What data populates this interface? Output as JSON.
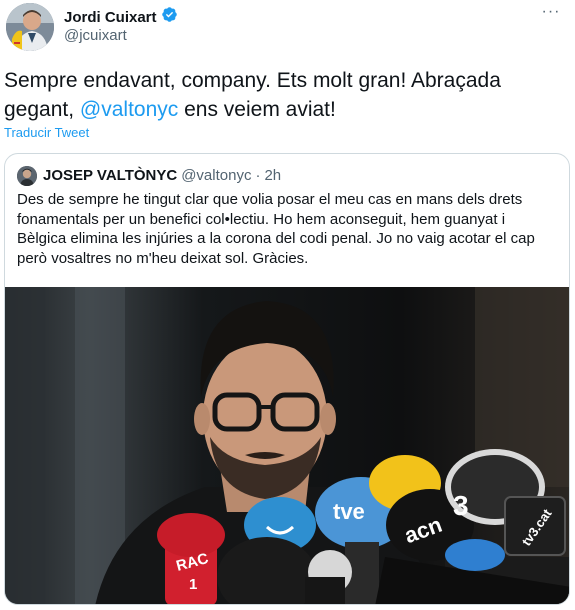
{
  "tweet": {
    "author_name": "Jordi Cuixart",
    "author_handle": "@jcuixart",
    "more_label": "···",
    "text_before": "Sempre endavant, company. Ets molt gran! Abraçada gegant, ",
    "mention": "@valtonyc",
    "text_after": " ens veiem aviat!",
    "translate_label": "Traducir Tweet"
  },
  "quoted": {
    "author_name": "JOSEP VALTÒNYC",
    "author_handle": "@valtonyc",
    "separator": "·",
    "time": "2h",
    "text": "Des de sempre he tingut clar que volia posar el meu cas en mans dels drets fonamentals per un benefici col•lectiu. Ho hem aconseguit, hem guanyat i Bèlgica elimina les injúries a la corona del codi penal. Jo no vaig acotar el cap però vosaltres no m'heu deixat sol. Gràcies.",
    "image": {
      "mic_labels": {
        "rac": "RAC",
        "one": "1",
        "tve": "tve",
        "acn": "acn",
        "three": "3",
        "tv3cat": "tv3.cat"
      }
    }
  },
  "icons": {
    "verified": "verified-badge-icon",
    "more": "more-options-icon"
  },
  "colors": {
    "accent": "#1d9bf0",
    "secondary_text": "#536471",
    "border": "#cfd9de"
  }
}
